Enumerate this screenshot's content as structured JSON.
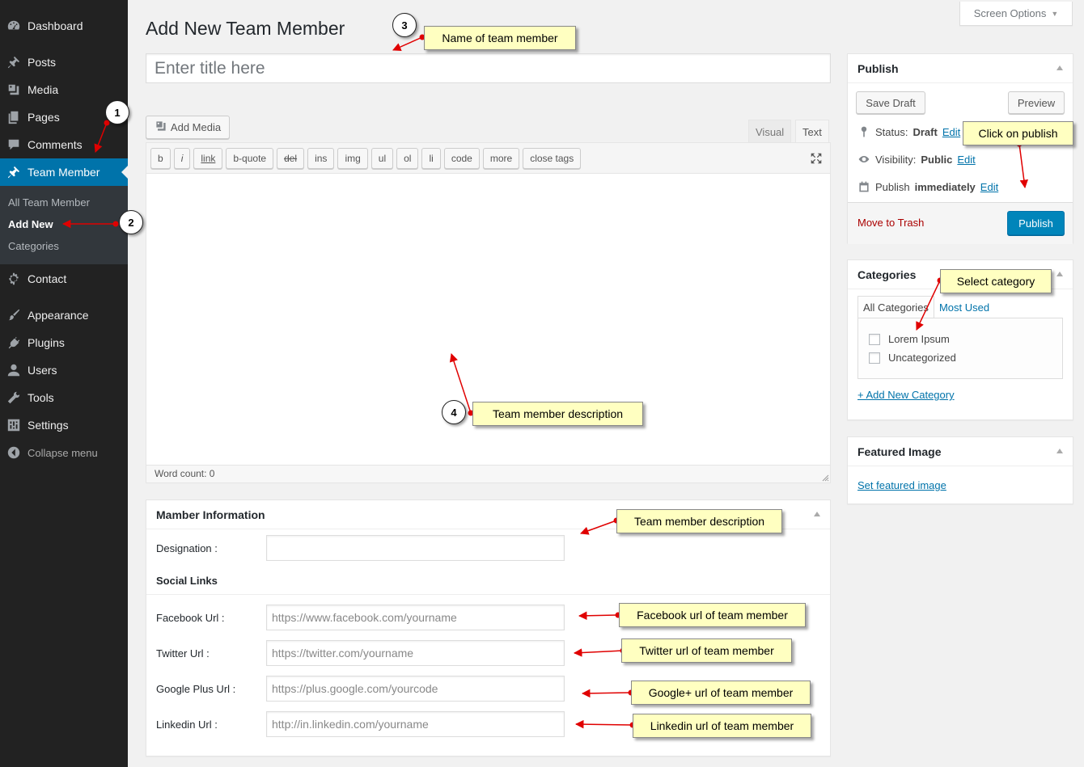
{
  "sidebar": {
    "items": [
      {
        "label": "Dashboard",
        "icon": "dashboard-icon"
      },
      {
        "label": "Posts",
        "icon": "pin-icon"
      },
      {
        "label": "Media",
        "icon": "media-icon"
      },
      {
        "label": "Pages",
        "icon": "pages-icon"
      },
      {
        "label": "Comments",
        "icon": "comment-icon"
      },
      {
        "label": "Team Member",
        "icon": "pin-icon"
      },
      {
        "label": "Contact",
        "icon": "gear-icon"
      },
      {
        "label": "Appearance",
        "icon": "brush-icon"
      },
      {
        "label": "Plugins",
        "icon": "plug-icon"
      },
      {
        "label": "Users",
        "icon": "user-icon"
      },
      {
        "label": "Tools",
        "icon": "wrench-icon"
      },
      {
        "label": "Settings",
        "icon": "settings-icon"
      }
    ],
    "submenu": [
      "All Team Member",
      "Add New",
      "Categories"
    ],
    "collapse_label": "Collapse menu"
  },
  "header": {
    "title": "Add New Team Member",
    "screen_options": "Screen Options"
  },
  "editor": {
    "title_placeholder": "Enter title here",
    "add_media": "Add Media",
    "tab_visual": "Visual",
    "tab_text": "Text",
    "quicktags": [
      "b",
      "i",
      "link",
      "b-quote",
      "del",
      "ins",
      "img",
      "ul",
      "ol",
      "li",
      "code",
      "more",
      "close tags"
    ],
    "word_count": "Word count: 0"
  },
  "member_info": {
    "title": "Mamber Information",
    "designation_label": "Designation :",
    "designation_value": "",
    "social_heading": "Social Links",
    "facebook_label": "Facebook Url :",
    "facebook_placeholder": "https://www.facebook.com/yourname",
    "twitter_label": "Twitter Url :",
    "twitter_placeholder": "https://twitter.com/yourname",
    "google_label": "Google Plus Url :",
    "google_placeholder": "https://plus.google.com/yourcode",
    "linkedin_label": "Linkedin Url :",
    "linkedin_placeholder": "http://in.linkedin.com/yourname"
  },
  "publish": {
    "title": "Publish",
    "save_draft": "Save Draft",
    "preview": "Preview",
    "status_label": "Status:",
    "status_value": "Draft",
    "visibility_label": "Visibility:",
    "visibility_value": "Public",
    "publish_label": "Publish",
    "publish_value": "immediately",
    "edit": "Edit",
    "trash": "Move to Trash",
    "publish_button": "Publish"
  },
  "categories": {
    "title": "Categories",
    "tab_all": "All Categories",
    "tab_most_used": "Most Used",
    "items": [
      "Lorem Ipsum",
      "Uncategorized"
    ],
    "add_new": "+ Add New Category"
  },
  "featured_image": {
    "title": "Featured Image",
    "set_link": "Set featured image"
  },
  "annotations": {
    "callouts": [
      "Name of team member",
      "Click on publish",
      "Select category",
      "Team member description",
      "Team member description",
      "Facebook url of team member",
      "Twitter url of team member",
      "Google+ url of team member",
      "Linkedin url of team member"
    ],
    "numbers": [
      "1",
      "2",
      "3",
      "4"
    ]
  },
  "colors": {
    "sidebar_bg": "#222222",
    "accent": "#0073aa",
    "publish_button": "#0085ba",
    "callout_bg": "#ffffc1",
    "arrow": "#e00000"
  }
}
